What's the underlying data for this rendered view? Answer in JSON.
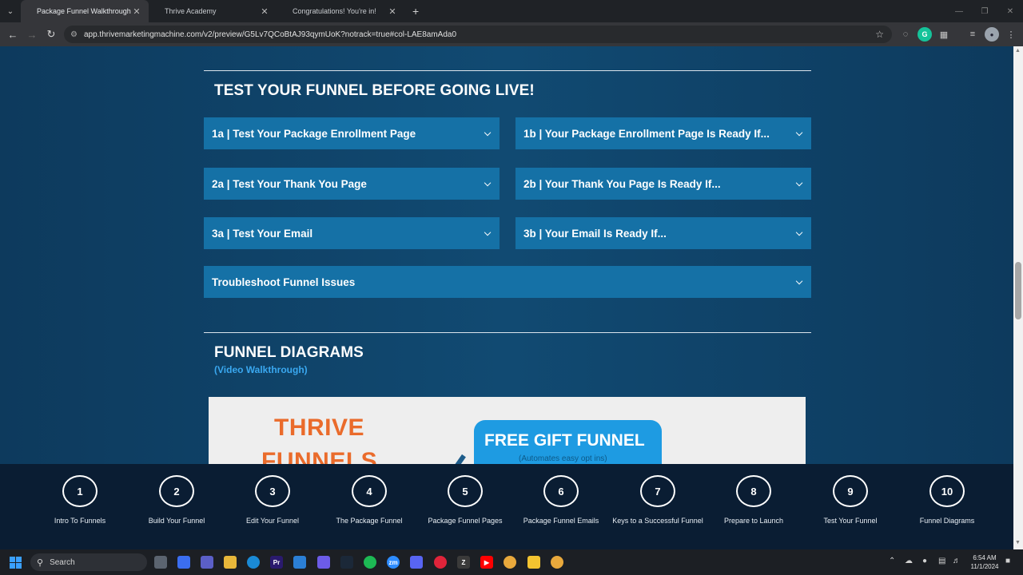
{
  "browser": {
    "tabs": [
      {
        "title": "Package Funnel Walkthrough (S",
        "active": true
      },
      {
        "title": "Thrive Academy",
        "active": false
      },
      {
        "title": "Congratulations! You're in!",
        "active": false
      }
    ],
    "new_tab": "+",
    "url": "app.thrivemarketingmachine.com/v2/preview/G5Lv7QCoBtAJ93qymUoK?notrack=true#col-LAE8amAda0"
  },
  "test_section": {
    "title": "TEST YOUR FUNNEL BEFORE GOING LIVE!",
    "accordions": [
      "1a | Test Your Package Enrollment Page",
      "1b | Your Package Enrollment Page Is Ready If...",
      "2a | Test Your Thank You Page",
      "2b | Your Thank You Page Is Ready If...",
      "3a | Test Your Email",
      "3b | Your Email Is Ready If...",
      "Troubleshoot Funnel Issues"
    ]
  },
  "diagrams_section": {
    "title": "FUNNEL DIAGRAMS",
    "subtitle": "(Video Walkthrough)",
    "image": {
      "brand_line1": "THRIVE",
      "brand_line2": "FUNNELS",
      "gift_title": "FREE GIFT FUNNEL",
      "gift_sub": "(Automates easy opt ins)"
    }
  },
  "steps": [
    {
      "num": "1",
      "label": "Intro To Funnels"
    },
    {
      "num": "2",
      "label": "Build Your Funnel"
    },
    {
      "num": "3",
      "label": "Edit Your Funnel"
    },
    {
      "num": "4",
      "label": "The Package Funnel"
    },
    {
      "num": "5",
      "label": "Package Funnel Pages"
    },
    {
      "num": "6",
      "label": "Package Funnel Emails"
    },
    {
      "num": "7",
      "label": "Keys to a Successful Funnel"
    },
    {
      "num": "8",
      "label": "Prepare to Launch"
    },
    {
      "num": "9",
      "label": "Test Your Funnel"
    },
    {
      "num": "10",
      "label": "Funnel Diagrams"
    }
  ],
  "taskbar": {
    "search_label": "Search",
    "time": "6:54 AM",
    "date": "11/1/2024"
  }
}
